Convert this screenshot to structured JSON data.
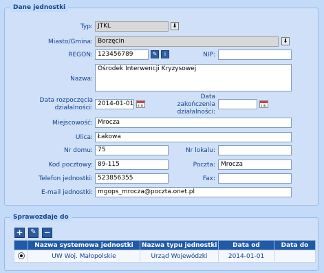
{
  "unit_section": {
    "legend": "Dane jednostki",
    "fields": {
      "typ": {
        "label": "Typ:",
        "value": "JTKL"
      },
      "miasto": {
        "label": "Miasto/Gmina:",
        "value": "Borzęcin"
      },
      "regon": {
        "label": "REGON:",
        "value": "123456789"
      },
      "nip": {
        "label": "NIP:",
        "value": ""
      },
      "nazwa": {
        "label": "Nazwa:",
        "value": "Ośrodek Interwencji Kryzysowej"
      },
      "data_rozp": {
        "label_line1": "Data rozpoczęcia",
        "label_line2": "działalności:",
        "value": "2014-01-01"
      },
      "data_zak": {
        "label_line1": "Data",
        "label_line2": "zakończenia",
        "label_line3": "działalności:",
        "value": ""
      },
      "miejscowosc": {
        "label": "Miejscowość:",
        "value": "Mrocza"
      },
      "ulica": {
        "label": "Ulica:",
        "value": "Łakowa"
      },
      "nr_domu": {
        "label": "Nr domu:",
        "value": "75"
      },
      "nr_lokalu": {
        "label": "Nr lokalu:",
        "value": ""
      },
      "kod": {
        "label": "Kod pocztowy:",
        "value": "89-115"
      },
      "poczta": {
        "label": "Poczta:",
        "value": "Mrocza"
      },
      "telefon": {
        "label": "Telefon jednostki:",
        "value": "523856355"
      },
      "fax": {
        "label": "Fax:",
        "value": ""
      },
      "email": {
        "label": "E-mail jednostki:",
        "value": "mgops_mrocza@poczta.onet.pl"
      }
    },
    "icons": {
      "dropdown": "⬇",
      "edit": "✎",
      "info": "i"
    }
  },
  "report_section": {
    "legend": "Sprawozdaje do",
    "toolbar": {
      "add": "+",
      "edit": "✎",
      "remove": "−"
    },
    "columns": [
      "",
      "Nazwa systemowa jednostki",
      "Nazwa typu jednostki",
      "Data od",
      "Data do"
    ],
    "rows": [
      {
        "name": "UW Woj. Małopolskie",
        "type": "Urząd Wojewódzki",
        "from": "2014-01-01",
        "to": ""
      }
    ]
  }
}
